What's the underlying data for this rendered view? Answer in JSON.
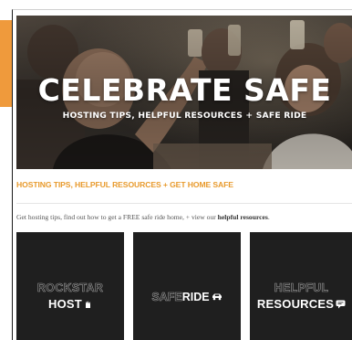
{
  "hero": {
    "title": "CELEBRATE SAFE",
    "subtitle": "HOSTING TIPS, HELPFUL RESOURCES + SAFE RIDE"
  },
  "section": {
    "heading": "HOSTING TIPS, HELPFUL RESOURCES + GET HOME SAFE",
    "intro_start": "Get hosting tips, find out how to get a FREE safe ride home, + view our ",
    "intro_link": "helpful resources",
    "intro_end": "."
  },
  "cards": [
    {
      "line1": "ROCKSTAR",
      "line2": "HOST",
      "icon": "hand-icon"
    },
    {
      "line1": "SAFE",
      "line2": "RIDE",
      "icon": "car-icon"
    },
    {
      "line1": "HELPFUL",
      "line2": "RESOURCES",
      "icon": "chat-icon"
    }
  ],
  "colors": {
    "accent_orange": "#ef9a3c",
    "heading_orange": "#e89a2c",
    "card_bg": "#1f1f1f"
  }
}
